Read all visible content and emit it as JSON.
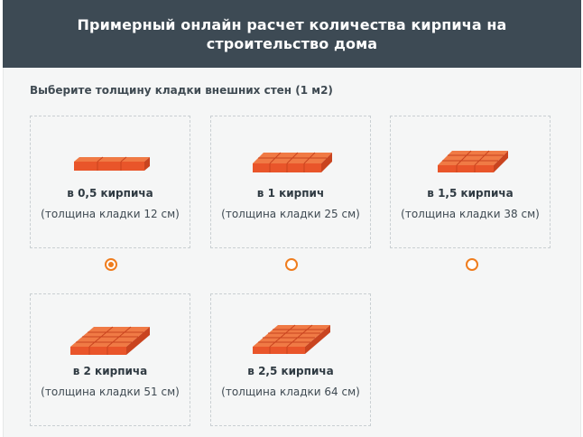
{
  "header": {
    "title": "Примерный онлайн расчет количества кирпича на строительство дома"
  },
  "subtitle": "Выберите толщину кладки внешних стен (1 м2)",
  "colors": {
    "header_bg": "#3d4a54",
    "accent": "#ef7d1e",
    "brick": "#ea5a2a"
  },
  "options": [
    {
      "title": "в 0,5 кирпича",
      "note": "(толщина кладки 12 см)",
      "selected": true,
      "icon": "brick-half-icon"
    },
    {
      "title": "в 1 кирпич",
      "note": "(толщина кладки 25 см)",
      "selected": false,
      "icon": "brick-one-icon"
    },
    {
      "title": "в 1,5 кирпича",
      "note": "(толщина кладки 38 см)",
      "selected": false,
      "icon": "brick-one-half-icon"
    },
    {
      "title": "в 2 кирпича",
      "note": "(толщина кладки 51 см)",
      "selected": false,
      "icon": "brick-two-icon"
    },
    {
      "title": "в 2,5 кирпича",
      "note": "(толщина кладки 64 см)",
      "selected": false,
      "icon": "brick-two-half-icon"
    }
  ]
}
